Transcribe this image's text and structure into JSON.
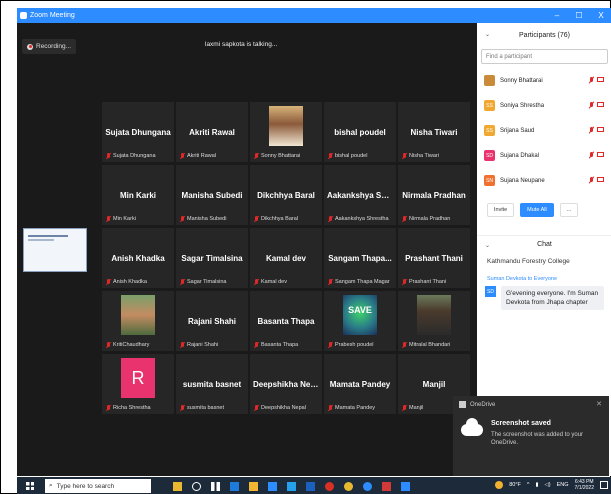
{
  "window": {
    "title": "Zoom Meeting",
    "controls": [
      "–",
      "☐",
      "X"
    ]
  },
  "meeting": {
    "recording_label": "Recording...",
    "active_speaker": "laxmi sapkota is talking...",
    "tiles": [
      {
        "display": "Sujata Dhungana",
        "label": "Sujata Dhungana",
        "kind": "name"
      },
      {
        "display": "Akriti Rawal",
        "label": "Akriti Rawal",
        "kind": "name"
      },
      {
        "display": "",
        "label": "Sonny Bhattarai",
        "kind": "photo",
        "photo": "sonny"
      },
      {
        "display": "bishal poudel",
        "label": "bishal poudel",
        "kind": "name"
      },
      {
        "display": "Nisha Tiwari",
        "label": "Nisha Tiwari",
        "kind": "name"
      },
      {
        "display": "Min Karki",
        "label": "Min Karki",
        "kind": "name"
      },
      {
        "display": "Manisha Subedi",
        "label": "Manisha Subedi",
        "kind": "name"
      },
      {
        "display": "Dikchhya Baral",
        "label": "Dikchhya Baral",
        "kind": "name"
      },
      {
        "display": "Aakankshya Shr...",
        "label": "Aakankshya Shrestha",
        "kind": "name"
      },
      {
        "display": "Nirmala Pradhan",
        "label": "Nirmala Pradhan",
        "kind": "name"
      },
      {
        "display": "Anish Khadka",
        "label": "Anish Khadka",
        "kind": "name"
      },
      {
        "display": "Sagar Timalsina",
        "label": "Sagar Timalsina",
        "kind": "name"
      },
      {
        "display": "Kamal dev",
        "label": "Kamal dev",
        "kind": "name"
      },
      {
        "display": "Sangam Thapa...",
        "label": "Sangam Thapa Magar",
        "kind": "name"
      },
      {
        "display": "Prashant Thani",
        "label": "Prashant Thani",
        "kind": "name"
      },
      {
        "display": "",
        "label": "KritiChaudhary",
        "kind": "photo",
        "photo": "kriti"
      },
      {
        "display": "Rajani Shahi",
        "label": "Rajani Shahi",
        "kind": "name"
      },
      {
        "display": "Basanta Thapa",
        "label": "Basanta Thapa",
        "kind": "name"
      },
      {
        "display": "SAVE",
        "label": "Prabesh poudel",
        "kind": "photo",
        "photo": "prabesh"
      },
      {
        "display": "",
        "label": "Mitralal Bhandari",
        "kind": "photo",
        "photo": "mitralal"
      },
      {
        "display": "R",
        "label": "Richa Shrestha",
        "kind": "avatar"
      },
      {
        "display": "susmita basnet",
        "label": "susmita basnet",
        "kind": "name"
      },
      {
        "display": "Deepshikha Nepal",
        "label": "Deepshikha Nepal",
        "kind": "name"
      },
      {
        "display": "Mamata Pandey",
        "label": "Mamata Pandey",
        "kind": "name"
      },
      {
        "display": "Manjil",
        "label": "Manjil",
        "kind": "name"
      }
    ]
  },
  "participants": {
    "title": "Participants (76)",
    "search_placeholder": "Find a participant",
    "list": [
      {
        "name": "Sonny Bhattarai",
        "initials": "",
        "color": "#c98a3a"
      },
      {
        "name": "Soniya Shrestha",
        "initials": "SS",
        "color": "#f0a830"
      },
      {
        "name": "Srijana Saud",
        "initials": "SS",
        "color": "#f0a830"
      },
      {
        "name": "Sujana Dhakal",
        "initials": "SD",
        "color": "#e8336f"
      },
      {
        "name": "Sujana Neupane",
        "initials": "SN",
        "color": "#f07030"
      }
    ],
    "invite_label": "Invite",
    "mute_all_label": "Mute All",
    "more_label": "..."
  },
  "chat": {
    "title": "Chat",
    "prev_text": "Kathmandu Forestry College",
    "from_line": "Suman Devkota to Everyone",
    "sender_initials": "SD",
    "message": "G'evening everyone. I'm Suman Devkota from Jhapa chapter"
  },
  "toast": {
    "app": "OneDrive",
    "title": "Screenshot saved",
    "body": "The screenshot was added to your OneDrive."
  },
  "taskbar": {
    "search_placeholder": "Type here to search",
    "weather": "80°F",
    "lang": "ENG",
    "time": "6:43 PM",
    "date": "7/1/2022"
  },
  "colors": {
    "accent": "#2d8cff",
    "muted": "#e02828"
  }
}
